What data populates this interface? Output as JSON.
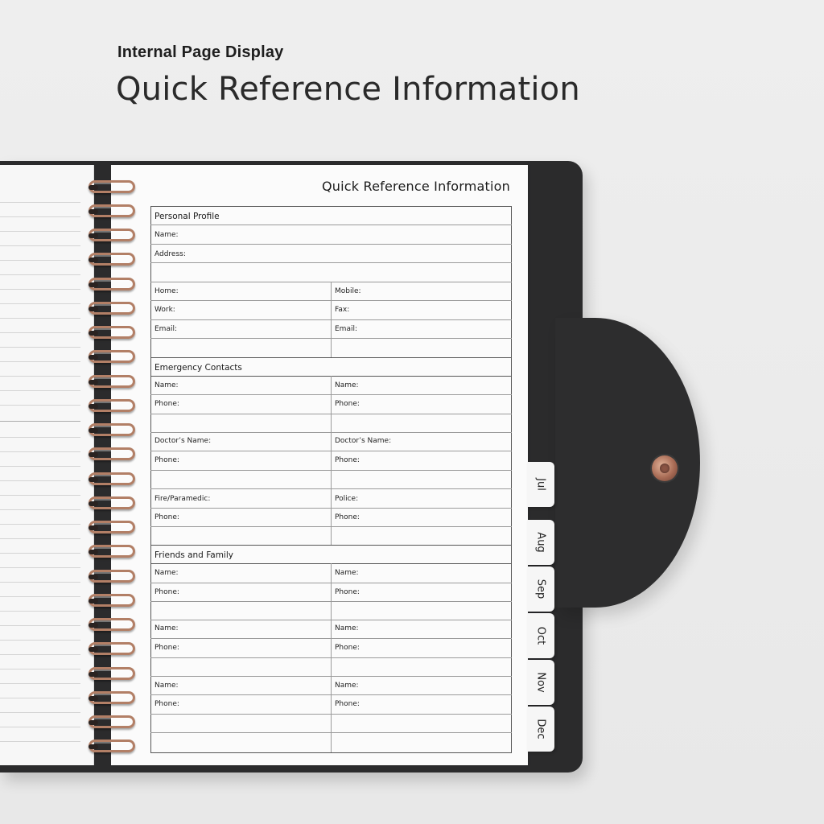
{
  "header": {
    "subtitle": "Internal Page Display",
    "title": "Quick Reference Information"
  },
  "page": {
    "title": "Quick Reference Information",
    "personal_profile": {
      "section": "Personal Profile",
      "name": "Name:",
      "address": "Address:",
      "home": "Home:",
      "mobile": "Mobile:",
      "work": "Work:",
      "fax": "Fax:",
      "email_left": "Email:",
      "email_right": "Email:"
    },
    "emergency": {
      "section": "Emergency Contacts",
      "name_l": "Name:",
      "name_r": "Name:",
      "phone_l1": "Phone:",
      "phone_r1": "Phone:",
      "doctor_l": "Doctor’s Name:",
      "doctor_r": "Doctor’s Name:",
      "phone_l2": "Phone:",
      "phone_r2": "Phone:",
      "fire": "Fire/Paramedic:",
      "police": "Police:",
      "phone_l3": "Phone:",
      "phone_r3": "Phone:"
    },
    "friends": {
      "section": "Friends and Family",
      "entries": [
        {
          "name_l": "Name:",
          "name_r": "Name:",
          "phone_l": "Phone:",
          "phone_r": "Phone:"
        },
        {
          "name_l": "Name:",
          "name_r": "Name:",
          "phone_l": "Phone:",
          "phone_r": "Phone:"
        },
        {
          "name_l": "Name:",
          "name_r": "Name:",
          "phone_l": "Phone:",
          "phone_r": "Phone:"
        }
      ]
    }
  },
  "tabs": [
    "Jul",
    "Aug",
    "Sep",
    "Oct",
    "Nov",
    "Dec"
  ],
  "colors": {
    "cover": "#2b2b2c",
    "ring": "#b27f66",
    "snap": "#a86b55",
    "paper": "#fbfbfb"
  }
}
